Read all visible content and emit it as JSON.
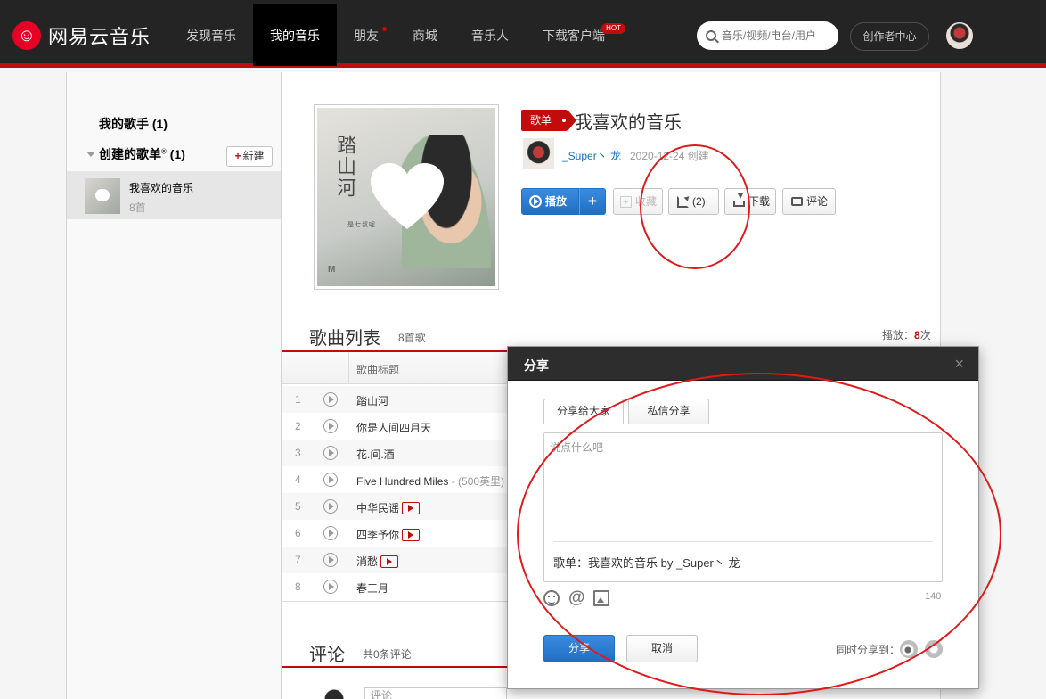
{
  "header": {
    "logo_text": "网易云音乐",
    "nav": [
      {
        "label": "发现音乐",
        "active": false
      },
      {
        "label": "我的音乐",
        "active": true
      },
      {
        "label": "朋友",
        "active": false,
        "dot": true
      },
      {
        "label": "商城",
        "active": false
      },
      {
        "label": "音乐人",
        "active": false
      },
      {
        "label": "下载客户端",
        "active": false,
        "badge": "HOT"
      }
    ],
    "search_placeholder": "音乐/视频/电台/用户",
    "creator_center": "创作者中心"
  },
  "sidebar": {
    "my_singers": "我的歌手 (1)",
    "created_playlists": "创建的歌单",
    "created_playlists_mark": "®",
    "created_playlists_count": " (1)",
    "new_button": "新建",
    "new_plus": "+",
    "items": [
      {
        "name": "我喜欢的音乐",
        "count": "8首"
      }
    ]
  },
  "playlist": {
    "tag": "歌单",
    "title": "我喜欢的音乐",
    "cover_title": "踏山河",
    "cover_sub": "是七叔呢",
    "cover_mark": "M",
    "creator": "_Super丶 龙",
    "created": "2020-12-24 创建",
    "buttons": {
      "play": "播放",
      "add": "+",
      "collect": "收藏",
      "share": "(2)",
      "download": "下载",
      "comment": "评论"
    }
  },
  "songs": {
    "title": "歌曲列表",
    "count": "8首歌",
    "play_label": "播放：",
    "play_count": "8",
    "play_suffix": "次",
    "header_title": "歌曲标题",
    "rows": [
      {
        "idx": "1",
        "name": "踏山河",
        "alias": "",
        "mv": false
      },
      {
        "idx": "2",
        "name": "你是人间四月天",
        "alias": "",
        "mv": false
      },
      {
        "idx": "3",
        "name": "花.间.酒",
        "alias": "",
        "mv": false
      },
      {
        "idx": "4",
        "name": "Five Hundred Miles",
        "alias": " - (500英里)",
        "mv": false
      },
      {
        "idx": "5",
        "name": "中华民谣",
        "alias": "",
        "mv": true
      },
      {
        "idx": "6",
        "name": "四季予你",
        "alias": "",
        "mv": true
      },
      {
        "idx": "7",
        "name": "消愁",
        "alias": "",
        "mv": true
      },
      {
        "idx": "8",
        "name": "春三月",
        "alias": "",
        "mv": false
      }
    ]
  },
  "comments": {
    "title": "评论",
    "count": "共0条评论",
    "input_placeholder": "评论"
  },
  "share_dialog": {
    "title": "分享",
    "close": "×",
    "tab_public": "分享给大家",
    "tab_private": "私信分享",
    "placeholder": "说点什么吧",
    "quote": "歌单：我喜欢的音乐 by _Super丶 龙",
    "char_count": "140",
    "share_button": "分享",
    "cancel_button": "取消",
    "also_share": "同时分享到："
  }
}
